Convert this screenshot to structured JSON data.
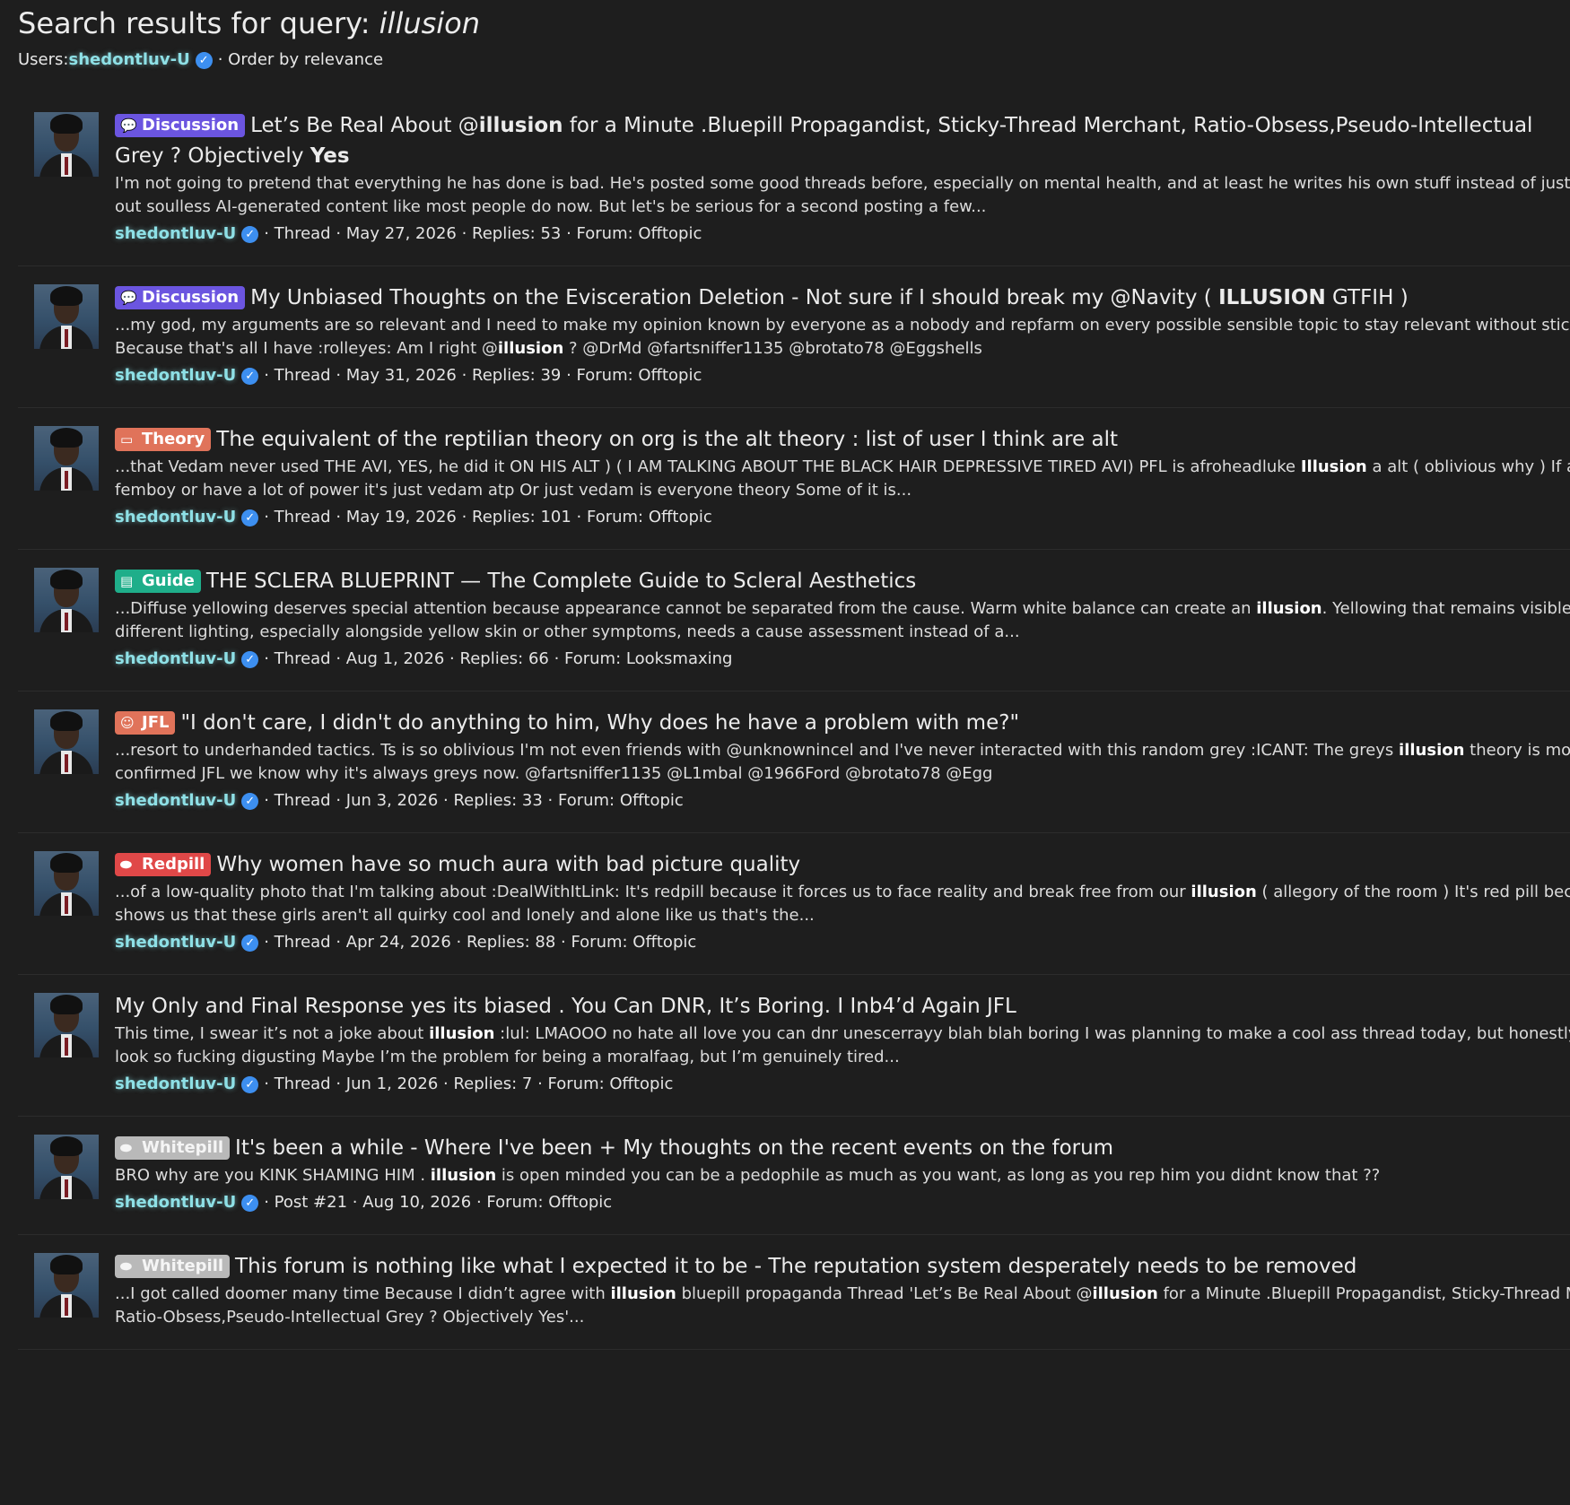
{
  "header": {
    "title_prefix": "Search results for query: ",
    "query": "illusion",
    "users_label": "Users: ",
    "user": "shedontluv-U",
    "order_text": "· Order by relevance"
  },
  "icons": {
    "verified": "verified-check-icon",
    "avatar": "user-avatar"
  },
  "colors": {
    "background": "#1e1e1e",
    "username": "#8ee0e6",
    "verified": "#3d8ff0",
    "discussion": "#6b55e0",
    "theory": "#e0735a",
    "guide": "#1fae8a",
    "redpill": "#e04848",
    "whitepill": "#b9b9b9"
  },
  "results": [
    {
      "label": "Discussion",
      "title": [
        "Let’s Be Real About @",
        "illusion",
        " for a Minute .Bluepill Propagandist, Sticky-Thread Merchant, Ratio-Obsess,Pseudo-Intellectual Grey ? Objectively ",
        "Yes",
        ""
      ],
      "snippet": [
        "I'm not going to pretend that everything he has done is bad. He's posted some good threads before, especially on mental health, and at least he writes his own stuff instead of just spewing",
        "out soulless AI-generated content like most people do now. But let's be serious for a second posting a few..."
      ],
      "author": "shedontluv-U",
      "meta": "· Thread · May 27, 2026 · Replies: 53 · Forum: Offtopic"
    },
    {
      "label": "Discussion",
      "title": [
        "My Unbiased Thoughts on the Evisceration Deletion - Not sure if I should break my @Navity ( ",
        "ILLUSION",
        " GTFIH )",
        "",
        ""
      ],
      "snippet": [
        "...my god, my arguments are so relevant and I need to make my opinion known by everyone as a nobody and repfarm on every possible sensible topic to stay relevant without stick or statue",
        "Because that's all I have :rolleyes: Am I right @illusion ? @DrMd @fartsniffer1135 @brotato78 @Eggshells"
      ],
      "author": "shedontluv-U",
      "meta": "· Thread · May 31, 2026 · Replies: 39 · Forum: Offtopic"
    },
    {
      "label": "Theory",
      "title": [
        "The equivalent of the reptilian theory on org is the alt theory : list of user I think are alt",
        "",
        "",
        "",
        ""
      ],
      "snippet": [
        "...that Vedam never used THE AVI, YES, he did it ON HIS ALT ) ( I AM TALKING ABOUT THE BLACK HAIR DEPRESSIVE TIRED AVI) PFL is afroheadluke Illusion a alt ( oblivious why ) If a user is a",
        "femboy or have a lot of power it's just vedam atp Or just vedam is everyone theory Some of it is..."
      ],
      "author": "shedontluv-U",
      "meta": "· Thread · May 19, 2026 · Replies: 101 · Forum: Offtopic"
    },
    {
      "label": "Guide",
      "title": [
        "THE SCLERA BLUEPRINT — The Complete Guide to Scleral Aesthetics",
        "",
        "",
        "",
        ""
      ],
      "snippet": [
        "...Diffuse yellowing deserves special attention because appearance cannot be separated from the cause. Warm white balance can create an illusion. Yellowing that remains visible under",
        "different lighting, especially alongside yellow skin or other symptoms, needs a cause assessment instead of a..."
      ],
      "author": "shedontluv-U",
      "meta": "· Thread · Aug 1, 2026 · Replies: 66 · Forum: Looksmaxing"
    },
    {
      "label": "JFL",
      "title": [
        "\"I don't care, I didn't do anything to him, Why does he have a problem with me?\"",
        "",
        "",
        "",
        ""
      ],
      "snippet": [
        "...resort to underhanded tactics. Ts is so oblivious I'm not even friends with @unknownincel and I've never interacted with this random grey :ICANT: The greys illusion theory is more than",
        "confirmed JFL we know why it's always greys now. @fartsniffer1135 @L1mbal @1966Ford @brotato78 @Egg"
      ],
      "author": "shedontluv-U",
      "meta": "· Thread · Jun 3, 2026 · Replies: 33 · Forum: Offtopic"
    },
    {
      "label": "Redpill",
      "title": [
        "Why women have so much aura with bad picture quality",
        "",
        "",
        "",
        ""
      ],
      "snippet": [
        "...of a low-quality photo that I'm talking about :DealWithItLink: It's redpill because it forces us to face reality and break free from our illusion ( allegory of the room ) It's red pill because it",
        "shows us that these girls aren't all quirky cool and lonely and alone like us that's the..."
      ],
      "author": "shedontluv-U",
      "meta": "· Thread · Apr 24, 2026 · Replies: 88 · Forum: Offtopic"
    },
    {
      "label": "",
      "title": [
        "My Only and Final Response yes its biased . You Can DNR, It’s Boring. I Inb4’d Again JFL",
        "",
        "",
        "",
        ""
      ],
      "snippet": [
        "This time, I swear it’s not a joke about illusion :lul: LMAOOO no hate all love you can dnr unescerrayy blah blah boring I was planning to make a cool ass thread today, but honestly offtopic",
        "look so fucking digusting Maybe I’m the problem for being a moralfaag, but I’m genuinely tired..."
      ],
      "author": "shedontluv-U",
      "meta": "· Thread · Jun 1, 2026 · Replies: 7 · Forum: Offtopic"
    },
    {
      "label": "Whitepill",
      "title": [
        "It's been a while - Where I've been + My thoughts on the recent events on the forum",
        "",
        "",
        "",
        ""
      ],
      "snippet": [
        "BRO why are you KINK SHAMING HIM . illusion is open minded you can be a pedophile as much as you want, as long as you rep him you didnt know that ??",
        ""
      ],
      "author": "shedontluv-U",
      "meta": "· Post #21 · Aug 10, 2026 · Forum: Offtopic"
    },
    {
      "label": "Whitepill",
      "title": [
        "This forum is nothing like what I expected it to be - The reputation system desperately needs to be removed",
        "",
        "",
        "",
        ""
      ],
      "snippet": [
        "...I got called doomer many time Because I didn’t agree with illusion bluepill propaganda Thread 'Let’s Be Real About @illusion for a Minute .Bluepill Propagandist, Sticky-Thread Merchant,",
        "Ratio-Obsess,Pseudo-Intellectual Grey ? Objectively Yes'..."
      ],
      "author": "",
      "meta": ""
    }
  ]
}
